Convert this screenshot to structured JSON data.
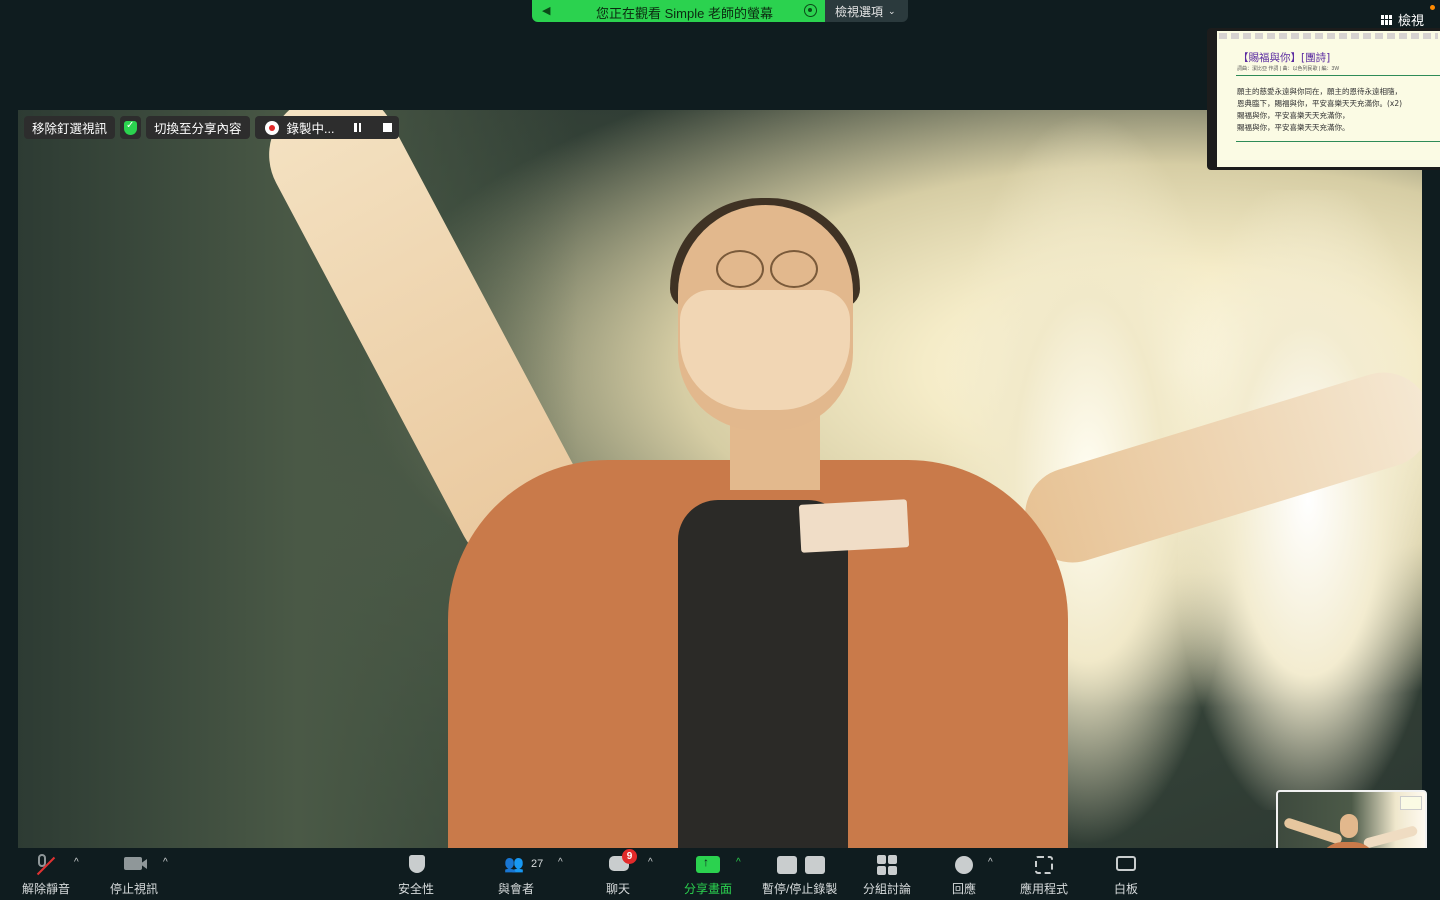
{
  "share_bar": {
    "status_text": "您正在觀看 Simple 老師的螢幕",
    "view_options_label": "檢視選項",
    "view_options_chevron": "⌄"
  },
  "top_right": {
    "view_label": "檢視"
  },
  "video_controls": {
    "unpin_label": "移除釘選視訊",
    "switch_label": "切換至分享內容",
    "recording_label": "錄製中..."
  },
  "shared_slide": {
    "title": "【賜福與你】[團詩]",
    "subtitle": "詞曲：潔比亞 作詞 | 曲：以色列民歌 | 編：3W",
    "lines": [
      "願主的慈愛永遠與你同在，願主的恩待永遠相隨，",
      "恩典臨下，賜福與你，平安喜樂天天充滿你。(x2)",
      "賜福與你，平安喜樂天天充滿你，",
      "賜福與你，平安喜樂天天充滿你。"
    ]
  },
  "toolbar": {
    "unmute": "解除靜音",
    "stop_video": "停止視訊",
    "security": "安全性",
    "participants": "與會者",
    "participants_count": "27",
    "chat": "聊天",
    "chat_badge": "9",
    "share_screen": "分享畫面",
    "pause_stop_recording": "暫停/停止錄製",
    "breakout": "分組討論",
    "reactions": "回應",
    "apps": "應用程式",
    "whiteboard": "白板",
    "caret": "^"
  },
  "colors": {
    "accent_green": "#2bd24f",
    "toolbar_bg": "#0f1c1f",
    "record_red": "#e02828",
    "badge_red": "#e22a2a"
  },
  "icons": [
    "speaker-icon",
    "recording-icon",
    "view-grid-icon",
    "shield-icon",
    "pause-icon",
    "stop-icon",
    "mic-muted-icon",
    "camera-icon",
    "security-shield-icon",
    "participants-icon",
    "chat-icon",
    "share-screen-icon",
    "record-control-icon",
    "breakout-icon",
    "reactions-icon",
    "apps-icon",
    "whiteboard-icon"
  ]
}
